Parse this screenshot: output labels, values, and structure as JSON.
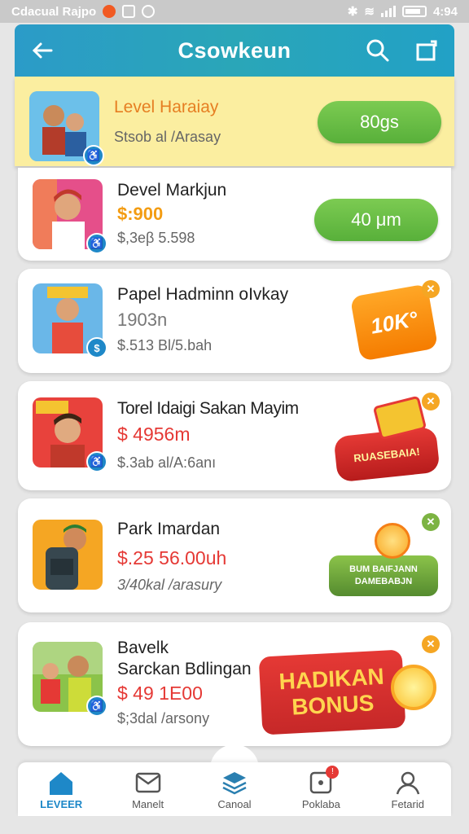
{
  "status_bar": {
    "app_text": "Cdacual Rajpo",
    "time": "4:94"
  },
  "header": {
    "title": "Csowkeun",
    "colors": {
      "start": "#2b9bc8",
      "end": "#22a1c6"
    }
  },
  "cards": [
    {
      "title": "Level Haraiay",
      "price": "",
      "subtitle": "Stsob al /Arasay",
      "button": "80gs",
      "title_color": "#e67e22"
    },
    {
      "title": "Devel Markjun",
      "price": "$:900",
      "subtitle": "$,3eβ 5.598",
      "button": "40 μm",
      "price_color": "#f39c12"
    },
    {
      "title": "Papel Hadminn oIvkay",
      "price": "1903n",
      "subtitle": "$.513 Bl/5.bah",
      "promo": "10K°",
      "price_color": "#777777"
    },
    {
      "title": "Torel Idaigi Sakan Mayim",
      "price": "$ 4956m",
      "subtitle": "$.3ab al/A:6anı",
      "promo": "RUASEBAIA!",
      "price_color": "#e53935"
    },
    {
      "title": "Park Imardan",
      "price": "$.25 56.00uh",
      "subtitle": "3/40kal /arasury",
      "promo_line1": "BUM BAIFJANN",
      "promo_line2": "DAMEBABJN",
      "price_color": "#e53935"
    },
    {
      "title_line1": "Bavelk",
      "title_line2": "Sarckan Bdlingan",
      "price": "$ 49 1E00",
      "subtitle": "$;3dal /arsony",
      "promo_line1": "HADIKAN",
      "promo_line2": "BONUS",
      "price_color": "#e53935"
    }
  ],
  "bottom_nav": [
    {
      "label": "LEVEER",
      "icon": "home-icon",
      "active": true
    },
    {
      "label": "Manelt",
      "icon": "mail-icon",
      "active": false
    },
    {
      "label": "Canoal",
      "icon": "layers-icon",
      "active": false
    },
    {
      "label": "Poklaba",
      "icon": "dice-icon",
      "active": false,
      "badge": "!"
    },
    {
      "label": "Fetarid",
      "icon": "profile-icon",
      "active": false
    }
  ]
}
